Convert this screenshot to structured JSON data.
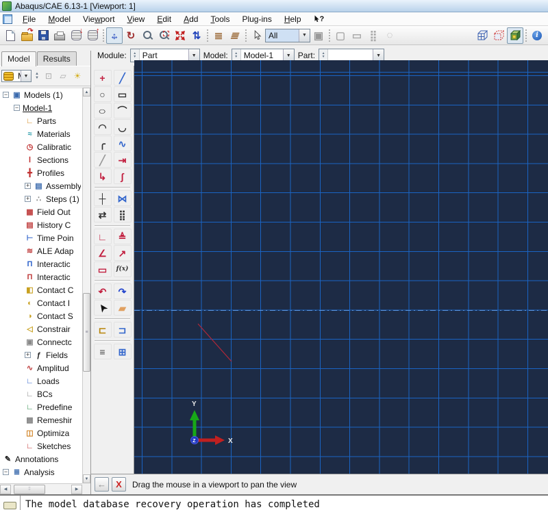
{
  "window": {
    "title": "Abaqus/CAE 6.13-1 [Viewport: 1]"
  },
  "menubar": {
    "items": [
      {
        "pre": "",
        "ul": "F",
        "post": "ile"
      },
      {
        "pre": "",
        "ul": "M",
        "post": "odel"
      },
      {
        "pre": "Vie",
        "ul": "w",
        "post": "port"
      },
      {
        "pre": "",
        "ul": "V",
        "post": "iew"
      },
      {
        "pre": "",
        "ul": "E",
        "post": "dit"
      },
      {
        "pre": "",
        "ul": "A",
        "post": "dd"
      },
      {
        "pre": "",
        "ul": "T",
        "post": "ools"
      },
      {
        "pre": "Plu",
        "ul": "g",
        "post": "-ins"
      },
      {
        "pre": "",
        "ul": "H",
        "post": "elp"
      }
    ]
  },
  "toolbar": {
    "selection_scope": "All"
  },
  "contextbar": {
    "module_label": "Module:",
    "module_value": "Part",
    "model_label": "Model:",
    "model_value": "Model-1",
    "part_label": "Part:",
    "part_value": ""
  },
  "left_panel": {
    "tabs": [
      "Model",
      "Results"
    ],
    "db_value": "M"
  },
  "tree": {
    "items": [
      {
        "label": "Models (1)",
        "level": 0,
        "expander": "minus",
        "glyph": "▣",
        "color": "#3a6aad"
      },
      {
        "label": "Model-1",
        "level": 1,
        "expander": "minus",
        "underline": true
      },
      {
        "label": "Parts",
        "level": 2,
        "glyph": "∟",
        "color": "#d4881c"
      },
      {
        "label": "Materials",
        "level": 2,
        "glyph": "≈",
        "color": "#2a9caa"
      },
      {
        "label": "Calibratic",
        "level": 2,
        "glyph": "◷",
        "color": "#c03030"
      },
      {
        "label": "Sections",
        "level": 2,
        "glyph": "Ⅰ",
        "color": "#c03030"
      },
      {
        "label": "Profiles",
        "level": 2,
        "glyph": "╋",
        "color": "#c03030"
      },
      {
        "label": "Assembly",
        "level": 2,
        "expander": "plus",
        "glyph": "▤",
        "color": "#3a6aad"
      },
      {
        "label": "Steps (1)",
        "level": 2,
        "expander": "plus",
        "glyph": "∴",
        "color": "#888888"
      },
      {
        "label": "Field Out",
        "level": 2,
        "glyph": "▦",
        "color": "#c04040"
      },
      {
        "label": "History C",
        "level": 2,
        "glyph": "▤",
        "color": "#c04040"
      },
      {
        "label": "Time Poin",
        "level": 2,
        "glyph": "⊢",
        "color": "#3366cc"
      },
      {
        "label": "ALE Adap",
        "level": 2,
        "glyph": "≋",
        "color": "#c04040"
      },
      {
        "label": "Interactic",
        "level": 2,
        "glyph": "Π",
        "color": "#3366cc"
      },
      {
        "label": "Interactic",
        "level": 2,
        "glyph": "Π",
        "color": "#c04040"
      },
      {
        "label": "Contact C",
        "level": 2,
        "glyph": "◧",
        "color": "#c8a020"
      },
      {
        "label": "Contact I",
        "level": 2,
        "glyph": "◐",
        "color": "#c8a020"
      },
      {
        "label": "Contact S",
        "level": 2,
        "glyph": "◑",
        "color": "#c8a020"
      },
      {
        "label": "Constrair",
        "level": 2,
        "glyph": "◁",
        "color": "#c8a020"
      },
      {
        "label": "Connectc",
        "level": 2,
        "glyph": "▣",
        "color": "#888888"
      },
      {
        "label": "Fields",
        "level": 2,
        "expander": "plus",
        "glyph": "ƒ",
        "color": "#222222"
      },
      {
        "label": "Amplitud",
        "level": 2,
        "glyph": "∿",
        "color": "#c04040"
      },
      {
        "label": "Loads",
        "level": 2,
        "glyph": "∟",
        "color": "#3366cc"
      },
      {
        "label": "BCs",
        "level": 2,
        "glyph": "∟",
        "color": "#888888"
      },
      {
        "label": "Predefine",
        "level": 2,
        "glyph": "∟",
        "color": "#2a8a4a"
      },
      {
        "label": "Remeshir",
        "level": 2,
        "glyph": "▩",
        "color": "#888888"
      },
      {
        "label": "Optimiza",
        "level": 2,
        "glyph": "◫",
        "color": "#d08020"
      },
      {
        "label": "Sketches",
        "level": 2,
        "glyph": "∟",
        "color": "#c03030"
      },
      {
        "label": "Annotations",
        "level": 0,
        "glyph": "✎",
        "color": "#222222"
      },
      {
        "label": "Analysis",
        "level": 0,
        "expander": "minus",
        "glyph": "≣",
        "color": "#3a6aad"
      }
    ]
  },
  "toolbox": {
    "groups": [
      [
        [
          {
            "name": "create-point",
            "g": "+",
            "c": "#c22040"
          },
          {
            "name": "create-lines",
            "g": "╱",
            "c": "#3366cc"
          }
        ],
        [
          {
            "name": "create-circle",
            "g": "○",
            "c": "#333333"
          },
          {
            "name": "create-rectangle",
            "g": "▭",
            "c": "#333333"
          }
        ],
        [
          {
            "name": "create-ellipse",
            "g": "○",
            "c": "#333333",
            "cls": "wide"
          },
          {
            "name": "create-arc-tangent",
            "g": "⌒",
            "c": "#333333"
          }
        ],
        [
          {
            "name": "create-arc-center-ends",
            "g": "◠",
            "c": "#333333"
          },
          {
            "name": "create-arc-3points",
            "g": "◡",
            "c": "#333333"
          }
        ],
        [
          {
            "name": "create-fillet",
            "g": "╭",
            "c": "#333333"
          },
          {
            "name": "create-spline",
            "g": "∿",
            "c": "#3366cc"
          }
        ],
        [
          {
            "name": "construction-line",
            "g": "╱",
            "c": "#999999"
          },
          {
            "name": "construction-offset",
            "g": "⇥",
            "c": "#c22040"
          }
        ],
        [
          {
            "name": "project-edges",
            "g": "↳",
            "c": "#c22040"
          },
          {
            "name": "offset-curves",
            "g": "∫",
            "c": "#c22040"
          }
        ]
      ],
      [
        [
          {
            "name": "trim-extend",
            "g": "┼",
            "c": "#333333"
          },
          {
            "name": "mirror",
            "g": "⋈",
            "c": "#3366cc"
          }
        ],
        [
          {
            "name": "translate-copy",
            "g": "⇄",
            "c": "#333333"
          },
          {
            "name": "linear-pattern",
            "g": "⣿",
            "c": "#333333"
          }
        ]
      ],
      [
        [
          {
            "name": "auto-dimension",
            "g": "∟",
            "c": "#c22040"
          },
          {
            "name": "add-constraint",
            "g": "≜",
            "c": "#c22040"
          }
        ],
        [
          {
            "name": "add-dimension",
            "g": "∠",
            "c": "#c22040"
          },
          {
            "name": "dimension-diagonal",
            "g": "↗",
            "c": "#c22040"
          }
        ],
        [
          {
            "name": "edit-dimension",
            "g": "▭",
            "c": "#c22040"
          },
          {
            "name": "parameter-manager",
            "g": "f(x)",
            "c": "#333333",
            "cls": "txt"
          }
        ]
      ],
      [
        [
          {
            "name": "undo",
            "g": "↶",
            "c": "#c22040"
          },
          {
            "name": "redo",
            "g": "↷",
            "c": "#2244cc"
          }
        ],
        [
          {
            "name": "select-cursor",
            "g": "➤",
            "c": "#111111",
            "cls": "rot-nw"
          },
          {
            "name": "delete-eraser",
            "g": "▰",
            "c": "#e0a060"
          }
        ]
      ],
      [
        [
          {
            "name": "sketch-open",
            "g": "⊏",
            "c": "#b8860b"
          },
          {
            "name": "sketch-save",
            "g": "⊐",
            "c": "#3366cc"
          }
        ]
      ],
      [
        [
          {
            "name": "sketcher-options",
            "g": "≡",
            "c": "#444444"
          },
          {
            "name": "grid-options",
            "g": "⊞",
            "c": "#3366cc"
          }
        ]
      ]
    ]
  },
  "viewport": {
    "triad": {
      "x": "X",
      "y": "Y",
      "z": "Z"
    },
    "colors": {
      "background": "#1d2b45",
      "grid": "#1a64c4",
      "axis_dash": "#5a95e0",
      "sketch_line": "#b02838"
    }
  },
  "prompt": {
    "text": "Drag the mouse in a viewport to pan the view"
  },
  "message_area": {
    "text": "The model database recovery operation has completed"
  },
  "icons": {
    "rotate-view": {
      "g": "↻",
      "c": "#a03030"
    },
    "cycle-views": {
      "g": "⇅",
      "c": "#2244bb"
    },
    "perspective-off": {
      "g": "≣",
      "c": "#996633"
    },
    "perspective-on": {
      "g": "≣",
      "c": "#996633"
    },
    "overlap-squares": {
      "g": "▣",
      "c": "#999999"
    },
    "sel-cube": {
      "g": "▢",
      "c": "#aaaaaa"
    },
    "sel-rect": {
      "g": "▭",
      "c": "#aaaaaa"
    },
    "sel-dots": {
      "g": "⣿",
      "c": "#aaaaaa"
    },
    "sel-lasso": {
      "g": "◌",
      "c": "#aaaaaa"
    },
    "info-i": {
      "g": "i",
      "c": "#ffffff"
    },
    "spin-up": {
      "g": "▲",
      "c": "#667788"
    },
    "spin-down": {
      "g": "▼",
      "c": "#667788"
    },
    "dropdown": {
      "g": "▼",
      "c": "#333333"
    },
    "tree-folder-up": {
      "g": "⊡",
      "c": "#aaaaaa"
    },
    "tree-create": {
      "g": "▱",
      "c": "#aaaaaa"
    },
    "lightbulb": {
      "g": "☀",
      "c": "#d4b020"
    },
    "prompt-back": {
      "g": "←",
      "c": "#888888"
    },
    "prompt-cancel": {
      "g": "X",
      "c": "#cc2222"
    },
    "help-q": {
      "g": "?",
      "c": "#111111"
    },
    "hscroll-left": {
      "g": "◀",
      "c": "#556677"
    },
    "hscroll-right": {
      "g": "▶",
      "c": "#556677"
    },
    "vscroll-up": {
      "g": "▲",
      "c": "#556677"
    },
    "vscroll-down": {
      "g": "▼",
      "c": "#556677"
    },
    "vthumb-grip": {
      "g": "≡",
      "c": "#889"
    },
    "hthumb-grip": {
      "g": "⦙⦙",
      "c": "#889"
    }
  }
}
